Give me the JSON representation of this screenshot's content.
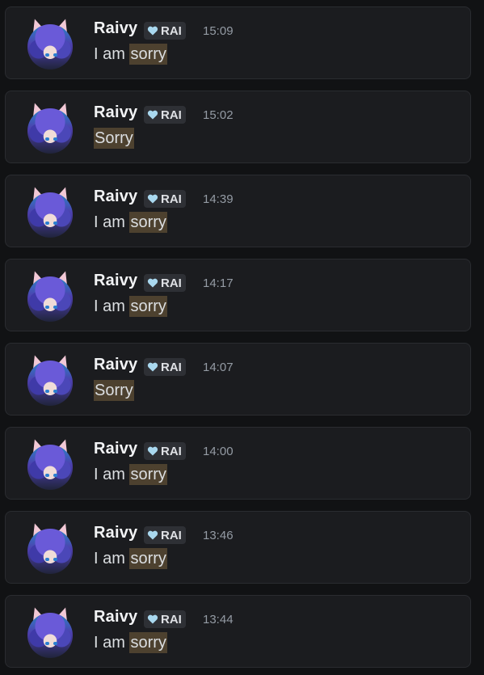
{
  "messages": [
    {
      "author": "Raivy",
      "tag": "RAI",
      "time": "15:09",
      "prefix": "I am ",
      "highlight": "sorry"
    },
    {
      "author": "Raivy",
      "tag": "RAI",
      "time": "15:02",
      "prefix": "",
      "highlight": "Sorry"
    },
    {
      "author": "Raivy",
      "tag": "RAI",
      "time": "14:39",
      "prefix": "I am ",
      "highlight": "sorry"
    },
    {
      "author": "Raivy",
      "tag": "RAI",
      "time": "14:17",
      "prefix": "I am ",
      "highlight": "sorry"
    },
    {
      "author": "Raivy",
      "tag": "RAI",
      "time": "14:07",
      "prefix": "",
      "highlight": "Sorry"
    },
    {
      "author": "Raivy",
      "tag": "RAI",
      "time": "14:00",
      "prefix": "I am ",
      "highlight": "sorry"
    },
    {
      "author": "Raivy",
      "tag": "RAI",
      "time": "13:46",
      "prefix": "I am ",
      "highlight": "sorry"
    },
    {
      "author": "Raivy",
      "tag": "RAI",
      "time": "13:44",
      "prefix": "I am ",
      "highlight": "sorry"
    }
  ],
  "icons": {
    "avatar": "anime-girl-avatar",
    "tag_icon": "heart-icon"
  },
  "colors": {
    "highlight_bg": "#4d412f",
    "card_bg": "#1b1c1f",
    "page_bg": "#111214",
    "tag_heart": "#a9d8ef"
  }
}
